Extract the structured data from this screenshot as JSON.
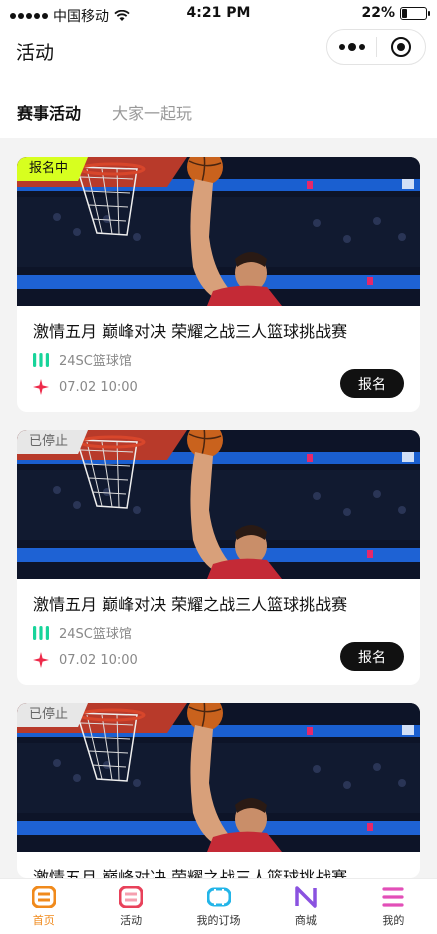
{
  "status": {
    "carrier": "中国移动",
    "time": "4:21 PM",
    "battery": "22%",
    "battery_level": 0.22
  },
  "nav": {
    "title": "活动"
  },
  "tabs": [
    {
      "label": "赛事活动",
      "active": true
    },
    {
      "label": "大家一起玩",
      "active": false
    }
  ],
  "cards": [
    {
      "badge": "报名中",
      "badge_state": "open",
      "title": "激情五月 巅峰对决 荣耀之战三人篮球挑战赛",
      "venue": "24SC篮球馆",
      "time": "07.02 10:00",
      "button": "报名"
    },
    {
      "badge": "已停止",
      "badge_state": "stopped",
      "title": "激情五月 巅峰对决 荣耀之战三人篮球挑战赛",
      "venue": "24SC篮球馆",
      "time": "07.02 10:00",
      "button": "报名"
    },
    {
      "badge": "已停止",
      "badge_state": "stopped",
      "title": "激情五月 巅峰对决 荣耀之战三人篮球挑战赛"
    }
  ],
  "tabbar": [
    {
      "label": "首页",
      "icon": "home-icon",
      "active": true,
      "color": "#f08a1c"
    },
    {
      "label": "活动",
      "icon": "activity-icon",
      "active": false,
      "color": "#e8415a"
    },
    {
      "label": "我的订场",
      "icon": "booking-icon",
      "active": false,
      "color": "#23b5e8"
    },
    {
      "label": "商城",
      "icon": "shop-icon",
      "active": false,
      "color": "#8a52e0"
    },
    {
      "label": "我的",
      "icon": "profile-icon",
      "active": false,
      "color": "#e24fb8"
    }
  ],
  "colors": {
    "accent": "#f08a1c",
    "badge_open": "#d7ff1f",
    "badge_stopped": "#e7e7e7",
    "button_bg": "#111111"
  }
}
